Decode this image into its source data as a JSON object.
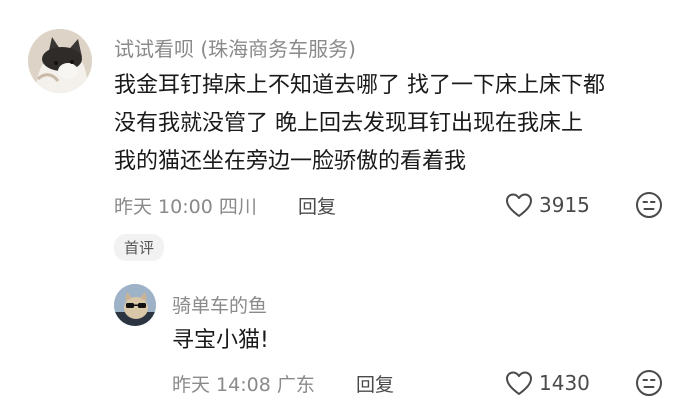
{
  "comment": {
    "username": "试试看呗 (珠海商务车服务)",
    "lines": [
      "我金耳钉掉床上不知道去哪了 找了一下床上床下都",
      "没有我就没管了 晚上回去发现耳钉出现在我床上",
      "我的猫还坐在旁边一脸骄傲的看着我"
    ],
    "time": "昨天 10:00 四川",
    "reply_label": "回复",
    "like_count": "3915",
    "tag": "首评"
  },
  "reply": {
    "username": "骑单车的鱼",
    "text": "寻宝小猫!",
    "time": "昨天 14:08 广东",
    "reply_label": "回复",
    "like_count": "1430"
  },
  "icons": {
    "like": "heart-outline-icon",
    "dislike": "meh-face-icon"
  },
  "colors": {
    "text": "#1a1a1a",
    "meta": "#8a8a8a",
    "tag_bg": "#f2f2f2"
  }
}
